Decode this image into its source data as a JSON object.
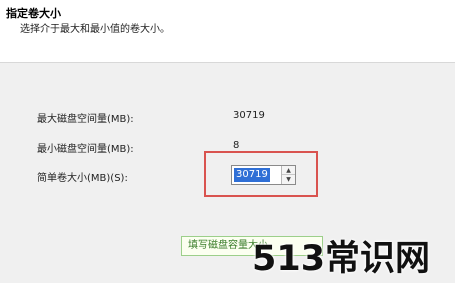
{
  "header": {
    "title": "指定卷大小",
    "subtitle": "选择介于最大和最小值的卷大小。"
  },
  "fields": {
    "max_label": "最大磁盘空间量(MB):",
    "max_value": "30719",
    "min_label": "最小磁盘空间量(MB):",
    "min_value": "8",
    "size_label": "简单卷大小(MB)(S):",
    "size_value": "30719"
  },
  "spin": {
    "up_icon": "chevron-up-icon",
    "down_icon": "chevron-down-icon"
  },
  "tooltip": {
    "text": "填写磁盘容量大小"
  },
  "watermark": {
    "text": "513常识网"
  },
  "colors": {
    "highlight": "#d9534f",
    "selection": "#2f6fd6",
    "tooltip_border": "#9ccf8a"
  }
}
